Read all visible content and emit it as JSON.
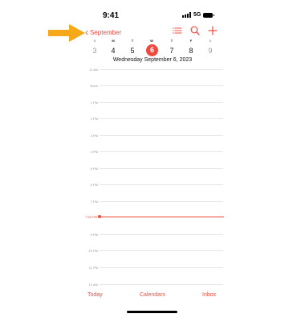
{
  "status_bar": {
    "time": "9:41",
    "network": "5G",
    "signal_icon": "signal-bars-icon",
    "battery_icon": "battery-icon"
  },
  "annotation": {
    "icon": "pointer-arrow-icon",
    "color": "#f5a818"
  },
  "nav": {
    "back_label": "September",
    "back_icon": "chevron-left-icon",
    "icons": [
      "list-icon",
      "search-icon",
      "add-icon"
    ]
  },
  "week": {
    "letters": [
      "S",
      "M",
      "T",
      "W",
      "T",
      "F",
      "S"
    ],
    "days": [
      "3",
      "4",
      "5",
      "6",
      "7",
      "8",
      "9"
    ],
    "selected_index": 3
  },
  "selected_date_label": "Wednesday  September 6, 2023",
  "hours": [
    "11 AM",
    "Noon",
    "1 PM",
    "2 PM",
    "3 PM",
    "4 PM",
    "5 PM",
    "6 PM",
    "7 PM",
    "9 PM",
    "10 PM",
    "11 PM",
    "12 AM"
  ],
  "current_time_label": "7:56 PM",
  "tabs": {
    "today": "Today",
    "calendars": "Calendars",
    "inbox": "Inbox"
  },
  "colors": {
    "accent": "#f04a3f",
    "muted_text": "#9a9a9a",
    "arrow": "#f5a818"
  }
}
